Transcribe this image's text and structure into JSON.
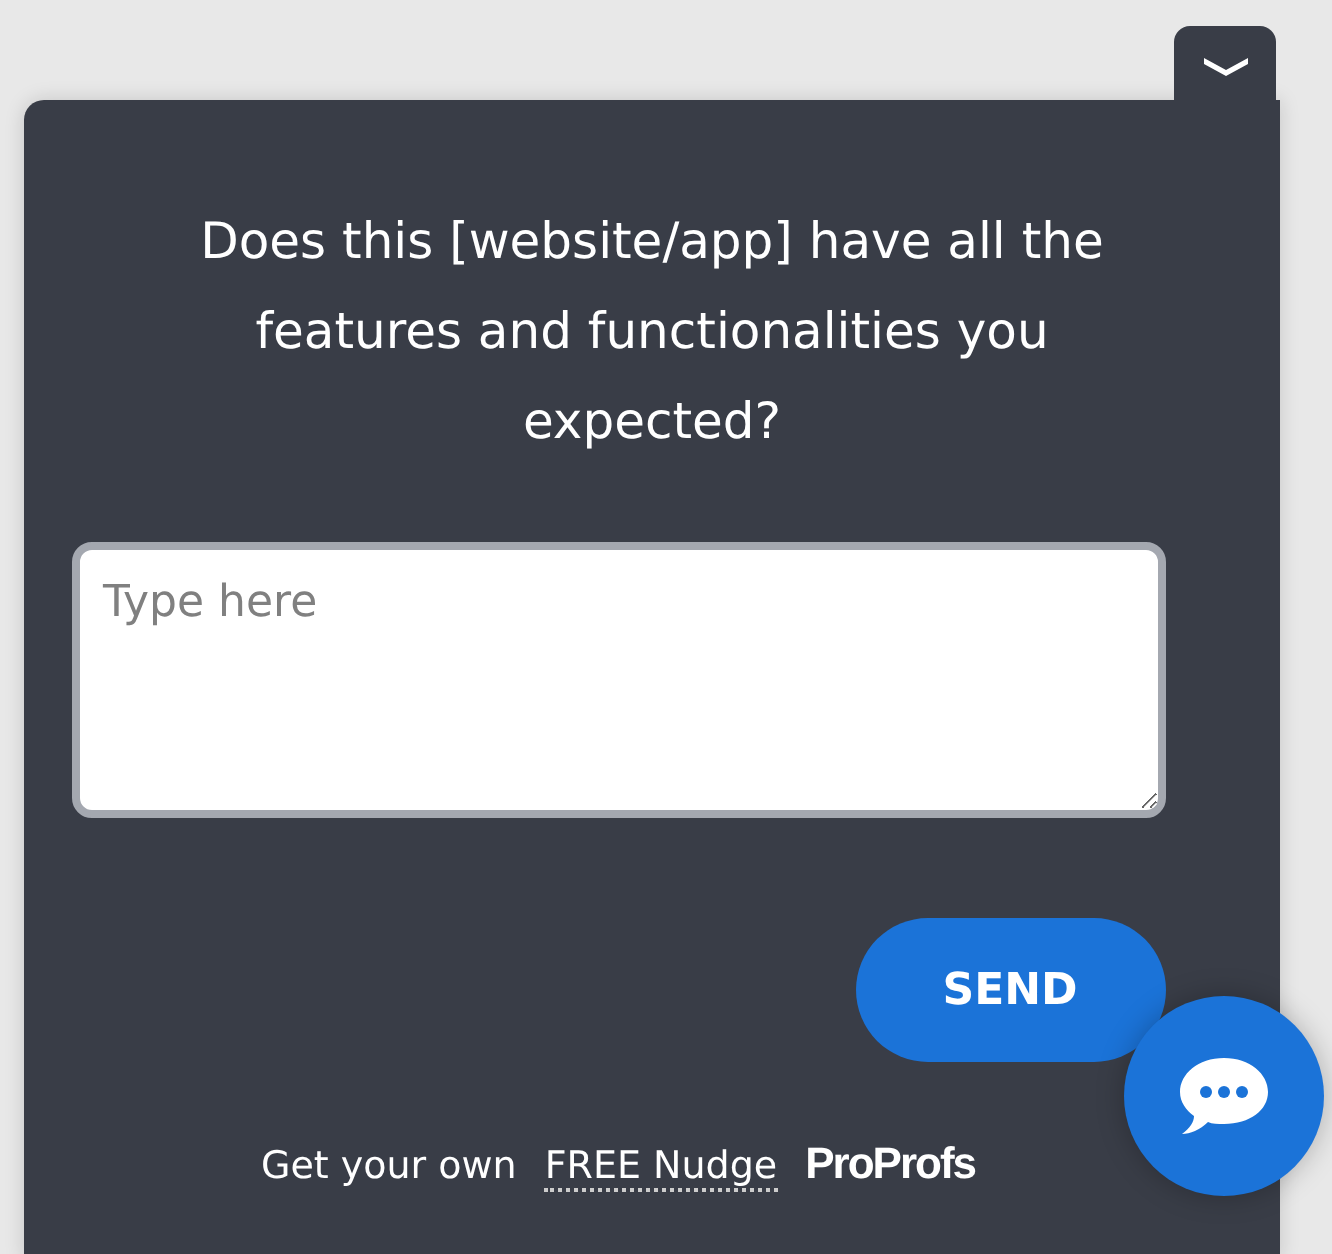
{
  "question": "Does this [website/app] have all the features and functionalities you expected?",
  "answer": {
    "placeholder": "Type here"
  },
  "send_button": "SEND",
  "footer": {
    "text": "Get your own",
    "link": "FREE Nudge",
    "brand": "ProProfs"
  }
}
